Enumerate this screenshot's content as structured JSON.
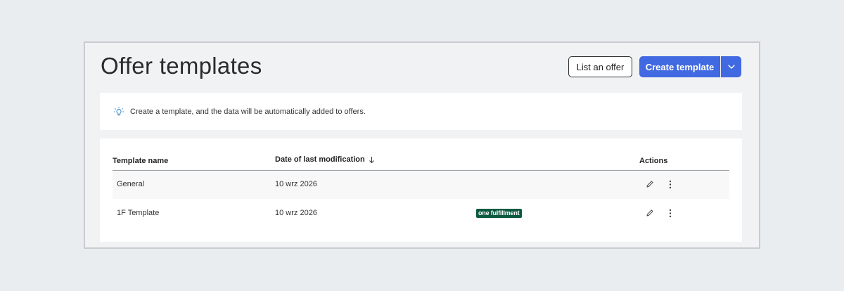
{
  "page": {
    "title": "Offer templates",
    "list_offer_label": "List an offer",
    "create_template_label": "Create template"
  },
  "info": {
    "text": "Create a template, and the data will be automatically added to offers."
  },
  "table": {
    "columns": {
      "name": "Template name",
      "date": "Date of last modification",
      "actions": "Actions"
    },
    "sort": "descending",
    "rows": [
      {
        "name": "General",
        "date": "10 wrz 2026",
        "badge": ""
      },
      {
        "name": "1F Template",
        "date": "10 wrz 2026",
        "badge": "one fulfillment"
      }
    ]
  },
  "icons": {
    "info": "lightbulb-icon",
    "sort": "arrow-down-icon",
    "dropdown": "chevron-down-icon",
    "edit": "pencil-icon",
    "more": "kebab-menu-icon"
  },
  "colors": {
    "primary": "#4169e1",
    "badge_bg": "#0b5a3f",
    "background": "#eaedf0"
  }
}
